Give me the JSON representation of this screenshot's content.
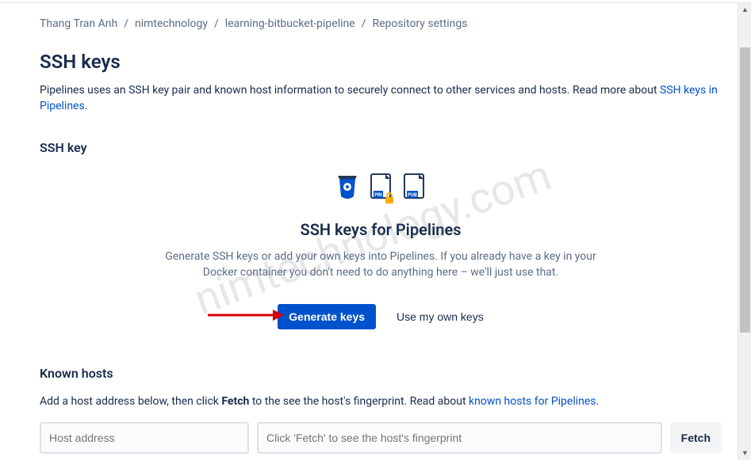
{
  "breadcrumb": {
    "items": [
      {
        "label": "Thang Tran Anh"
      },
      {
        "label": "nimtechnology"
      },
      {
        "label": "learning-bitbucket-pipeline"
      },
      {
        "label": "Repository settings"
      }
    ]
  },
  "page": {
    "title": "SSH keys",
    "description_prefix": "Pipelines uses an SSH key pair and known host information to securely connect to other services and hosts. Read more about ",
    "description_link": "SSH keys in Pipelines",
    "description_suffix": "."
  },
  "sshkey": {
    "heading": "SSH key",
    "icons": {
      "bucket": "bucket-icon",
      "pri": "PRI",
      "pub": "PUB"
    },
    "panel_title": "SSH keys for Pipelines",
    "panel_desc": "Generate SSH keys or add your own keys into Pipelines. If you already have a key in your Docker container you don't need to do anything here – we'll just use that.",
    "generate_label": "Generate keys",
    "ownkeys_label": "Use my own keys"
  },
  "known": {
    "heading": "Known hosts",
    "desc_prefix": "Add a host address below, then click ",
    "desc_bold": "Fetch",
    "desc_mid": " to the see the host's fingerprint. Read about ",
    "desc_link": "known hosts for Pipelines",
    "desc_suffix": ".",
    "host_placeholder": "Host address",
    "fp_placeholder": "Click 'Fetch' to see the host's fingerprint",
    "fetch_label": "Fetch"
  },
  "watermark": "nimtechnology.com"
}
